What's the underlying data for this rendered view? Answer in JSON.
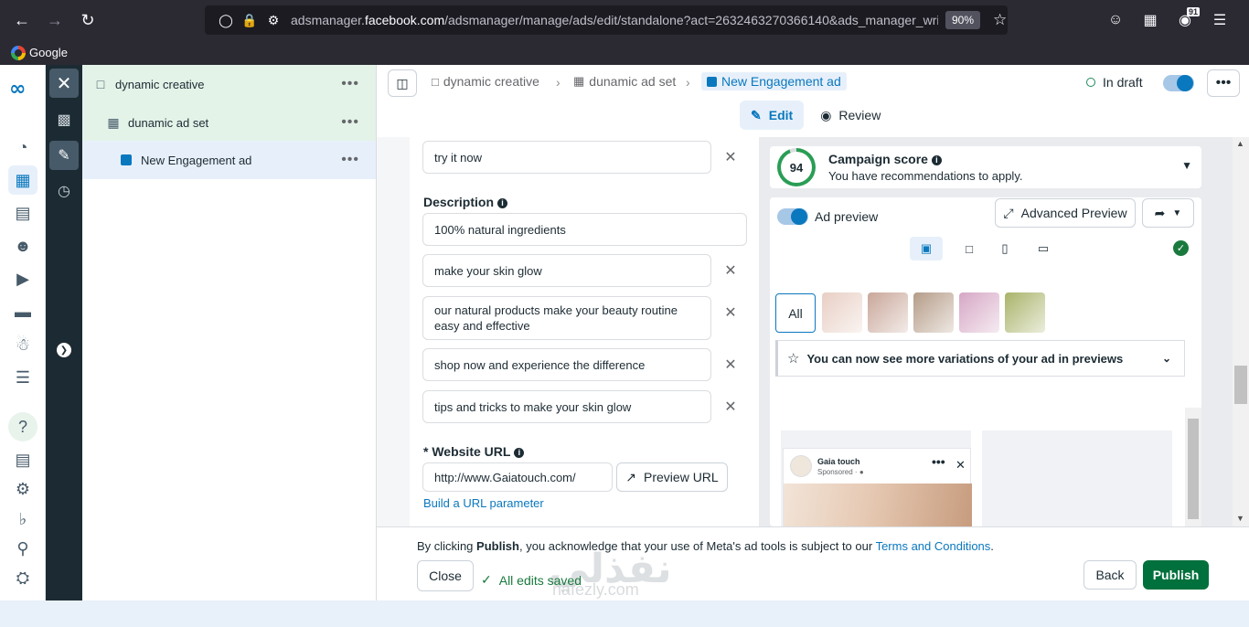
{
  "browser": {
    "url_prefix": "adsmanager.",
    "url_domain": "facebook.com",
    "url_path": "/adsmanager/manage/ads/edit/standalone?act=2632463270366140&ads_manager_write",
    "zoom": "90%",
    "extension_badge": "91",
    "bookmark": "Google"
  },
  "tree": {
    "campaign": "dynamic creative",
    "adset": "dunamic ad set",
    "ad": "New Engagement ad"
  },
  "header": {
    "crumb_campaign": "dynamic creative",
    "crumb_adset": "dunamic ad set",
    "crumb_ad": "New Engagement ad",
    "status": "In draft",
    "tab_edit": "Edit",
    "tab_review": "Review"
  },
  "editor": {
    "headline_last": "try it now",
    "description_label": "Description",
    "descriptions": [
      "100% natural ingredients",
      "make your skin glow",
      "our natural products make your beauty routine easy and effective",
      "shop now and experience the difference",
      "tips and tricks to make your skin glow"
    ],
    "website_label": "* Website URL",
    "website_value": "http://www.Gaiatouch.com/",
    "preview_url_label": "Preview URL",
    "build_param_link": "Build a URL parameter"
  },
  "preview": {
    "score": "94",
    "score_title": "Campaign score",
    "score_subtitle": "You have recommendations to apply.",
    "ad_preview_label": "Ad preview",
    "advanced_preview_label": "Advanced Preview",
    "all_label": "All",
    "banner_text": "You can now see more variations of your ad in previews",
    "page_name": "Gaia touch",
    "sponsored": "Sponsored · ",
    "thumb_colors": [
      "#e8cfc4",
      "#c9a79a",
      "#b59c88",
      "#d6a7c5",
      "#a9b36a"
    ]
  },
  "footer": {
    "text_prefix": "By clicking ",
    "text_bold": "Publish",
    "text_middle": ", you acknowledge that your use of Meta's ad tools is subject to our ",
    "terms_link": "Terms and Conditions",
    "text_end": ".",
    "close_label": "Close",
    "saved_label": "All edits saved",
    "back_label": "Back",
    "publish_label": "Publish",
    "watermark": "نفذلي",
    "watermark_sub": "nafezly.com"
  }
}
